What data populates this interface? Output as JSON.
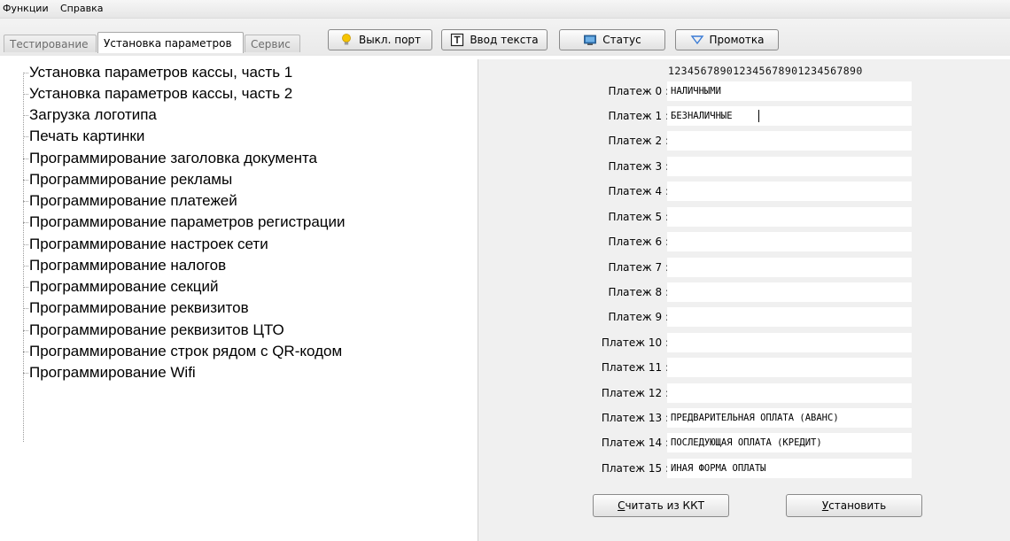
{
  "menu": {
    "items": [
      "Функции",
      "Справка"
    ]
  },
  "tabs": [
    {
      "label": "Тестирование",
      "active": false
    },
    {
      "label": "Установка параметров",
      "active": true
    },
    {
      "label": "Сервис",
      "active": false
    }
  ],
  "toolbar": {
    "port_label": "Выкл. порт",
    "text_label": "Ввод текста",
    "status_label": "Статус",
    "feed_label": "Промотка"
  },
  "tree": {
    "items": [
      "Установка параметров кассы, часть 1",
      "Установка параметров кассы, часть 2",
      "Загрузка логотипа",
      "Печать картинки",
      "Программирование заголовка документа",
      "Программирование рекламы",
      "Программирование платежей",
      "Программирование параметров регистрации",
      "Программирование настроек сети",
      "Программирование налогов",
      "Программирование секций",
      "Программирование реквизитов",
      "Программирование реквизитов ЦТО",
      "Программирование строк рядом с QR-кодом",
      "Программирование Wifi"
    ],
    "selected_index": 6
  },
  "panel": {
    "ruler": "123456789012345678901234567890",
    "payments": [
      {
        "label": "Платеж 0 :",
        "value": "НАЛИЧНЫМИ"
      },
      {
        "label": "Платеж 1 :",
        "value": "БЕЗНАЛИЧНЫЕ"
      },
      {
        "label": "Платеж 2 :",
        "value": ""
      },
      {
        "label": "Платеж 3 :",
        "value": ""
      },
      {
        "label": "Платеж 4 :",
        "value": ""
      },
      {
        "label": "Платеж 5 :",
        "value": ""
      },
      {
        "label": "Платеж 6 :",
        "value": ""
      },
      {
        "label": "Платеж 7 :",
        "value": ""
      },
      {
        "label": "Платеж 8 :",
        "value": ""
      },
      {
        "label": "Платеж 9 :",
        "value": ""
      },
      {
        "label": "Платеж 10 :",
        "value": ""
      },
      {
        "label": "Платеж 11 :",
        "value": ""
      },
      {
        "label": "Платеж 12 :",
        "value": ""
      },
      {
        "label": "Платеж 13 :",
        "value": "ПРЕДВАРИТЕЛЬНАЯ ОПЛАТА (АВАНС)"
      },
      {
        "label": "Платеж 14 :",
        "value": "ПОСЛЕДУЮЩАЯ ОПЛАТА (КРЕДИТ)"
      },
      {
        "label": "Платеж 15 :",
        "value": "ИНАЯ ФОРМА ОПЛАТЫ"
      }
    ],
    "read_button": {
      "mnemonic": "С",
      "rest": "читать из ККТ"
    },
    "set_button": {
      "mnemonic": "У",
      "rest": "становить"
    }
  },
  "colors": {
    "panel_bg": "#f0f0f0",
    "tab_inactive_text": "#6d6d6d",
    "status_icon": "#2d6fb0",
    "feed_icon": "#3a7bd5",
    "bulb_icon": "#f5c400"
  },
  "icons": {
    "port": "lightbulb-icon",
    "text": "text-box-icon",
    "status": "monitor-icon",
    "feed": "triangle-down-icon"
  }
}
